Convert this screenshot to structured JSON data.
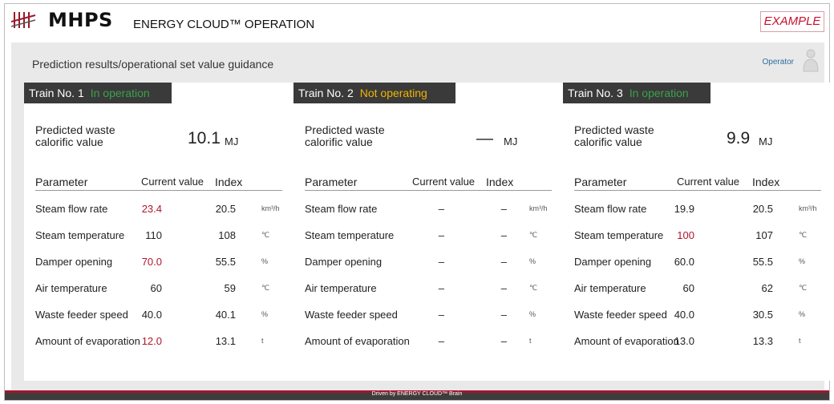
{
  "header": {
    "brand": "MHPS",
    "product": "ENERGY CLOUD™ OPERATION",
    "badge": "EXAMPLE"
  },
  "main": {
    "title": "Prediction results/operational set value guidance",
    "operator": "Operator"
  },
  "panels": [
    {
      "title": "Train No. 1",
      "status": "In operation",
      "status_color": "#3aa24a",
      "pred_label": "Predicted waste calorific value",
      "pred_value": "10.1",
      "pred_unit": "MJ",
      "cols": {
        "param": "Parameter",
        "current": "Current value",
        "index": "Index"
      },
      "rows": [
        {
          "name": "Steam flow rate",
          "current": "23.4",
          "index": "20.5",
          "unit": "km³/h",
          "highlight": true
        },
        {
          "name": "Steam temperature",
          "current": "110",
          "index": "108",
          "unit": "℃",
          "highlight": false
        },
        {
          "name": "Damper opening",
          "current": "70.0",
          "index": "55.5",
          "unit": "%",
          "highlight": true
        },
        {
          "name": "Air temperature",
          "current": "60",
          "index": "59",
          "unit": "℃",
          "highlight": false
        },
        {
          "name": "Waste feeder speed",
          "current": "40.0",
          "index": "40.1",
          "unit": "%",
          "highlight": false
        },
        {
          "name": "Amount of evaporation",
          "current": "12.0",
          "index": "13.1",
          "unit": "t",
          "highlight": true
        }
      ]
    },
    {
      "title": "Train No. 2",
      "status": "Not operating",
      "status_color": "#f0b400",
      "pred_label": "Predicted waste calorific value",
      "pred_value": "—",
      "pred_unit": "MJ",
      "cols": {
        "param": "Parameter",
        "current": "Current value",
        "index": "Index"
      },
      "rows": [
        {
          "name": "Steam flow rate",
          "current": "–",
          "index": "–",
          "unit": "km³/h",
          "highlight": false
        },
        {
          "name": "Steam temperature",
          "current": "–",
          "index": "–",
          "unit": "℃",
          "highlight": false
        },
        {
          "name": "Damper opening",
          "current": "–",
          "index": "–",
          "unit": "%",
          "highlight": false
        },
        {
          "name": "Air temperature",
          "current": "–",
          "index": "–",
          "unit": "℃",
          "highlight": false
        },
        {
          "name": "Waste feeder speed",
          "current": "–",
          "index": "–",
          "unit": "%",
          "highlight": false
        },
        {
          "name": "Amount of evaporation",
          "current": "–",
          "index": "–",
          "unit": "t",
          "highlight": false
        }
      ]
    },
    {
      "title": "Train No. 3",
      "status": "In operation",
      "status_color": "#3aa24a",
      "pred_label": "Predicted waste calorific value",
      "pred_value": "9.9",
      "pred_unit": "MJ",
      "cols": {
        "param": "Parameter",
        "current": "Current value",
        "index": "Index"
      },
      "rows": [
        {
          "name": "Steam flow rate",
          "current": "19.9",
          "index": "20.5",
          "unit": "km³/h",
          "highlight": false
        },
        {
          "name": "Steam temperature",
          "current": "100",
          "index": "107",
          "unit": "℃",
          "highlight": true
        },
        {
          "name": "Damper opening",
          "current": "60.0",
          "index": "55.5",
          "unit": "%",
          "highlight": false
        },
        {
          "name": "Air temperature",
          "current": "60",
          "index": "62",
          "unit": "℃",
          "highlight": false
        },
        {
          "name": "Waste feeder speed",
          "current": "40.0",
          "index": "30.5",
          "unit": "%",
          "highlight": false
        },
        {
          "name": "Amount of evaporation",
          "current": "13.0",
          "index": "13.3",
          "unit": "t",
          "highlight": false
        }
      ]
    }
  ],
  "footer": {
    "text": "Driven by ENERGY CLOUD™ Brain"
  },
  "colors": {
    "accent_red": "#b0162c",
    "header_dark": "#3a3a3a",
    "link_blue": "#2a6f9e"
  }
}
